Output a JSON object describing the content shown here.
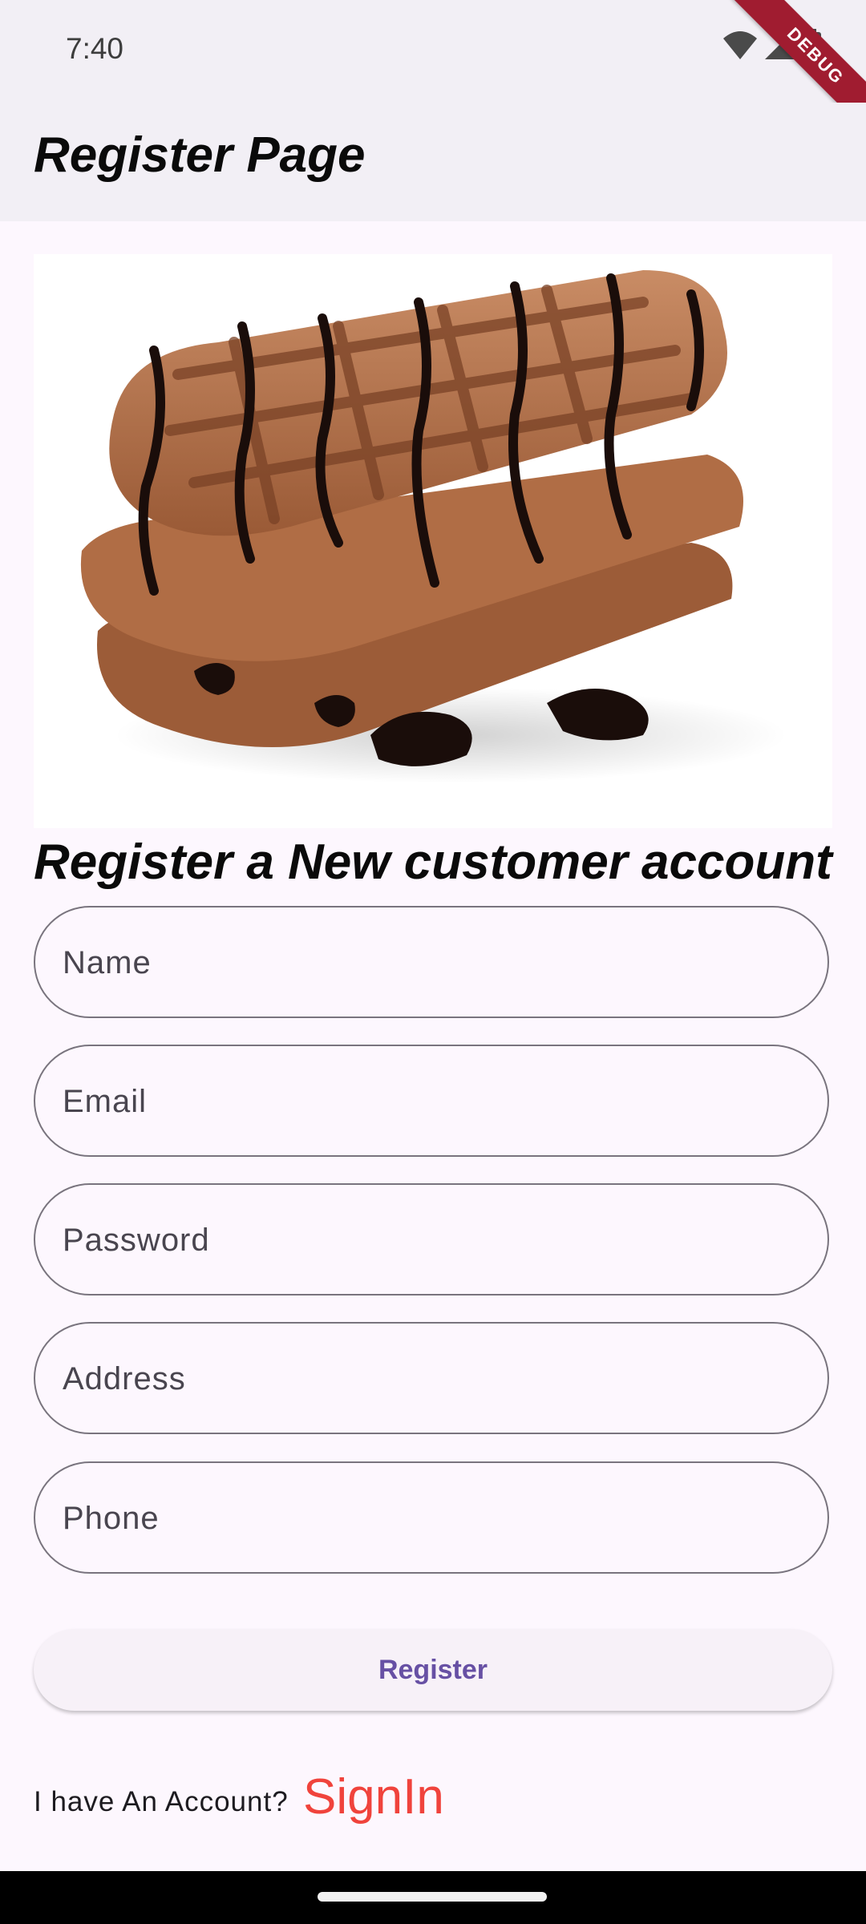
{
  "status_bar": {
    "time": "7:40",
    "icons": [
      "wifi-icon",
      "signal-icon",
      "battery-icon"
    ]
  },
  "debug_banner": "DEBUG",
  "app_bar": {
    "title": "Register Page"
  },
  "hero": {
    "image": "waffles-with-chocolate-syrup"
  },
  "form": {
    "heading": "Register a New customer account",
    "fields": {
      "name": {
        "placeholder": "Name"
      },
      "email": {
        "placeholder": "Email"
      },
      "password": {
        "placeholder": "Password"
      },
      "address": {
        "placeholder": "Address"
      },
      "phone": {
        "placeholder": "Phone"
      }
    },
    "register_label": "Register"
  },
  "footer": {
    "prompt": "I have An Account?",
    "signin_label": "SignIn"
  },
  "colors": {
    "primary": "#6750a4",
    "link": "#f0433c",
    "background": "#fdf7fe",
    "app_bar": "#f2eff5"
  }
}
